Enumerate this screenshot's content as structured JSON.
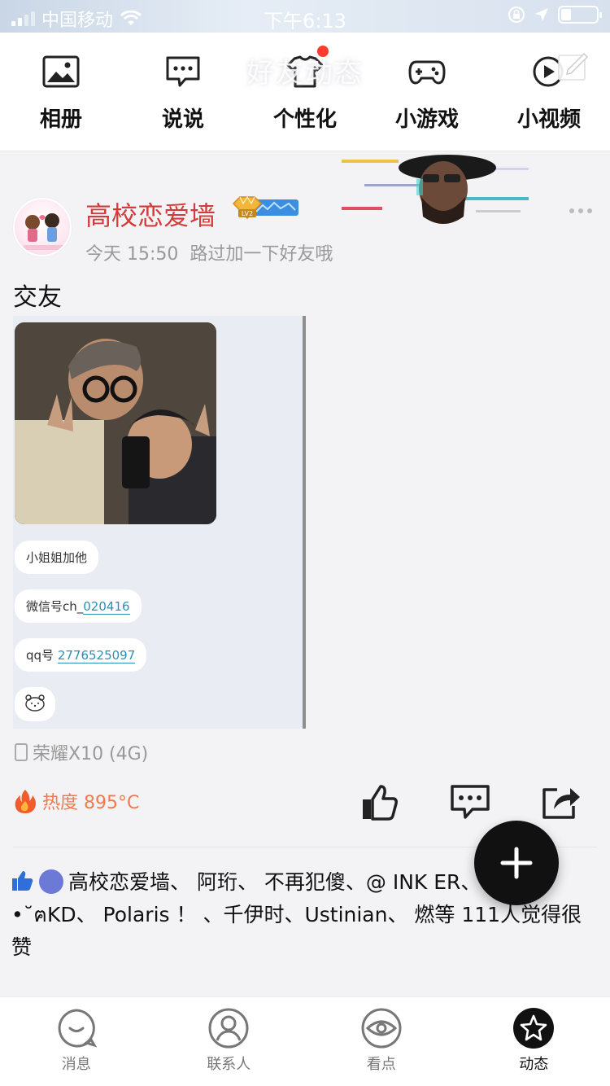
{
  "status_bar": {
    "carrier": "中国移动",
    "time": "下午6:13"
  },
  "header": {
    "title": "好友动态",
    "nav_items": [
      {
        "label": "相册",
        "icon": "photo-album-icon"
      },
      {
        "label": "说说",
        "icon": "chat-bubble-icon"
      },
      {
        "label": "个性化",
        "icon": "shirt-icon"
      },
      {
        "label": "小游戏",
        "icon": "gamepad-icon"
      },
      {
        "label": "小视频",
        "icon": "video-play-icon"
      }
    ]
  },
  "post": {
    "author": "高校恋爱墙",
    "badge_level": "LV2",
    "time": "今天 15:50",
    "source": "路过加一下好友哦",
    "text": "交友",
    "image": {
      "bubble1": "小姐姐加他",
      "bubble2_prefix": "微信号ch_",
      "bubble2_link": "020416",
      "bubble3_prefix": "qq号",
      "bubble3_link": "2776525097"
    },
    "device": "荣耀X10 (4G)",
    "heat": "热度 895°C",
    "likes": {
      "text_line": "高校恋爱墙、 阿珩、 不再犯傻、@ INK ER、ฅ˘• •˘ฅKD、 Polaris ！ 、千伊时、Ustinian、 燃等 111人觉得很赞"
    }
  },
  "tabbar": {
    "tabs": [
      {
        "label": "消息",
        "icon": "message-bubble-icon"
      },
      {
        "label": "联系人",
        "icon": "contacts-icon"
      },
      {
        "label": "看点",
        "icon": "eye-icon"
      },
      {
        "label": "动态",
        "icon": "star-icon"
      }
    ],
    "active_index": 3
  }
}
